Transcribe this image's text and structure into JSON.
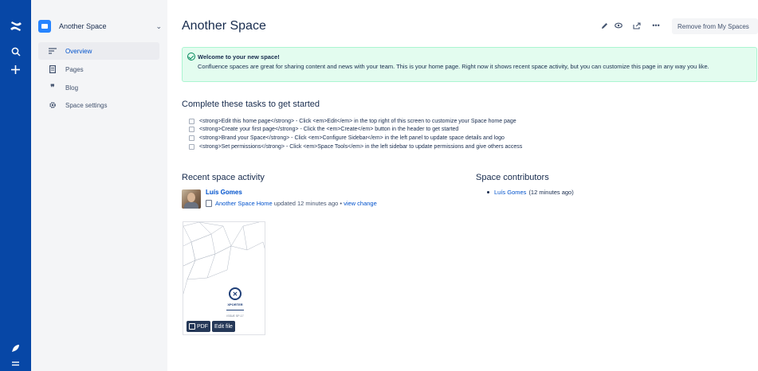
{
  "global_nav": {
    "icons": [
      "confluence-logo-icon",
      "search-icon",
      "create-icon",
      "feedback-rocket-icon",
      "menu-icon"
    ]
  },
  "sidebar": {
    "space_name": "Another Space",
    "items": [
      {
        "label": "Overview",
        "icon": "overview-icon",
        "active": true
      },
      {
        "label": "Pages",
        "icon": "pages-icon",
        "active": false
      },
      {
        "label": "Blog",
        "icon": "blog-quote-icon",
        "active": false
      },
      {
        "label": "Space settings",
        "icon": "gear-icon",
        "active": false
      }
    ]
  },
  "header": {
    "title": "Another Space",
    "toolbar_icons": [
      "edit-pencil-icon",
      "watch-eye-icon",
      "share-icon",
      "more-icon"
    ],
    "remove_button": "Remove from My Spaces"
  },
  "welcome": {
    "title": "Welcome to your new space!",
    "body": "Confluence spaces are great for sharing content and news with your team. This is your home page. Right now it shows recent space activity, but you can customize this page in any way you like."
  },
  "tasks": {
    "heading": "Complete these tasks to get started",
    "items": [
      "<strong>Edit this home page</strong> - Click <em>Edit</em> in the top right of this screen to customize your Space home page",
      "<strong>Create your first page</strong> - Click the <em>Create</em> button in the header to get started",
      "<strong>Brand your Space</strong> - Click <em>Configure Sidebar</em> in the left panel to update space details and logo",
      "<strong>Set permissions</strong> - Click <em>Space Tools</em> in the left sidebar to update permissions and give others access"
    ]
  },
  "activity": {
    "heading": "Recent space activity",
    "author": "Luís Gomes",
    "page_link": "Another Space Home",
    "update_text": " updated 12 minutes ago • ",
    "view_change": "view change"
  },
  "contributors": {
    "heading": "Space contributors",
    "items": [
      {
        "name": "Luís Gomes",
        "time": "(12 minutes ago)"
      }
    ]
  },
  "attachment": {
    "logo_text": "XPORTER",
    "issue_text": "ISSUE SP-17",
    "pdf_button": "PDF",
    "edit_button": "Edit file"
  },
  "colors": {
    "global_nav": "#0747a6",
    "sidebar": "#f4f5f7",
    "link": "#0052cc",
    "welcome_bg": "#e3fcef"
  }
}
